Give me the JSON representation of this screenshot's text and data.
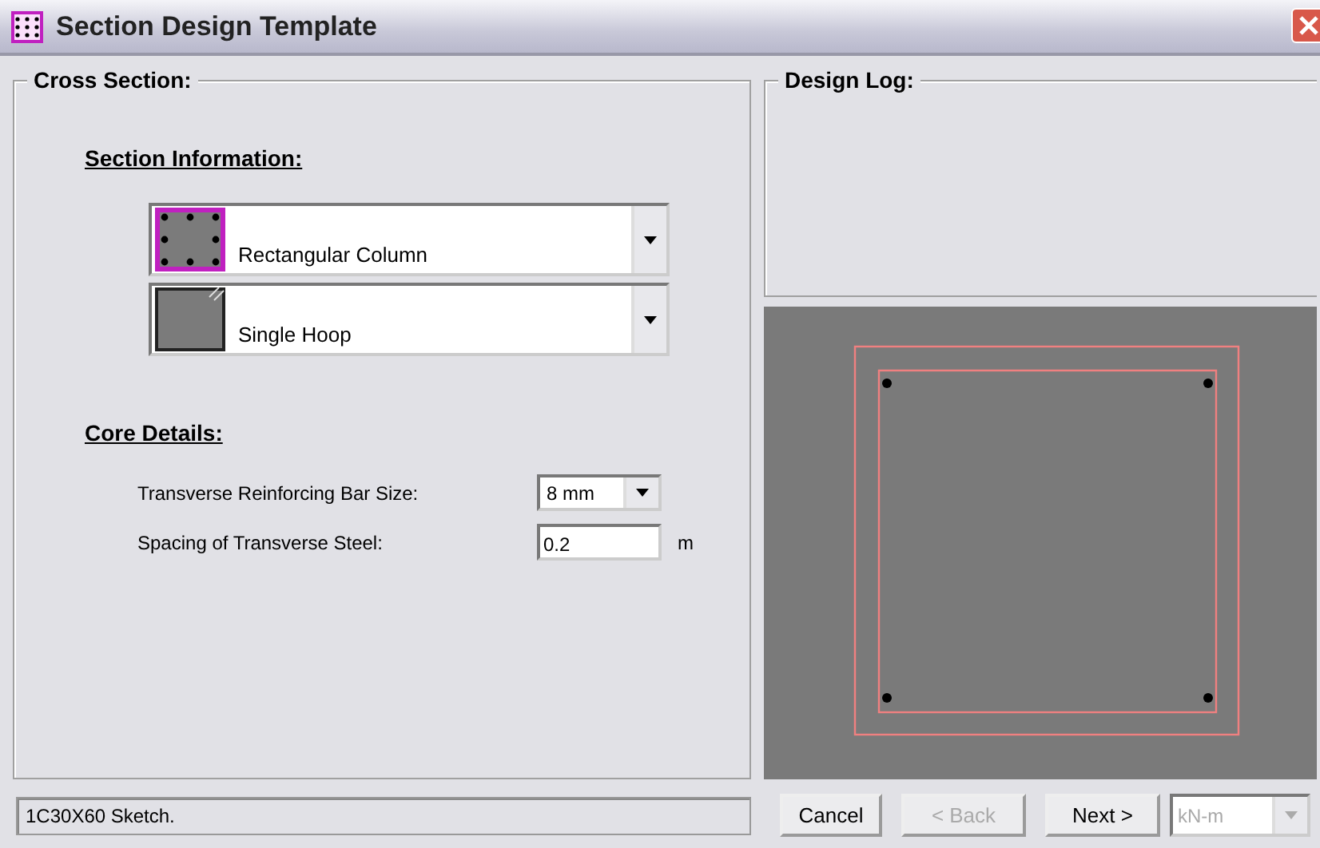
{
  "window": {
    "title": "Section Design Template"
  },
  "cross_section": {
    "title": "Cross Section:",
    "section_information": {
      "heading": "Section Information:",
      "section_type": {
        "value": "Rectangular Column",
        "kind": "column"
      },
      "hoop_type": {
        "value": "Single Hoop",
        "kind": "hoop"
      }
    },
    "core_details": {
      "heading": "Core Details:",
      "fields": [
        {
          "label": "Transverse Reinforcing Bar Size:",
          "value": "8 mm",
          "kind": "dropdown"
        },
        {
          "label": "Spacing of Transverse Steel:",
          "value": "0.2",
          "unit": "m",
          "kind": "input"
        }
      ]
    }
  },
  "design_log": {
    "title": "Design Log:"
  },
  "status_bar": {
    "text": "1C30X60 Sketch."
  },
  "buttons": [
    {
      "label": "Cancel",
      "disabled": false
    },
    {
      "label": "< Back",
      "disabled": true
    },
    {
      "label": "Next >",
      "disabled": false
    }
  ],
  "units": {
    "value": "kN-m",
    "disabled": true
  }
}
